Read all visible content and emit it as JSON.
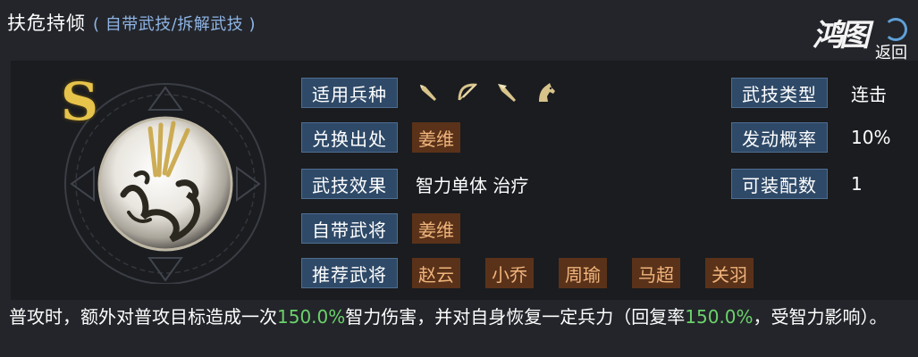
{
  "header": {
    "title": "扶危持倾",
    "subtitle": "( 自带武技/拆解武技 )",
    "logo_text": "鸿图",
    "return_label": "返回"
  },
  "skill": {
    "grade": "S",
    "fields": {
      "troops": {
        "label": "适用兵种",
        "icons": [
          "spear-icon",
          "bow-icon",
          "blade-icon",
          "horse-icon"
        ]
      },
      "source": {
        "label": "兑换出处",
        "value": "姜维"
      },
      "effect": {
        "label": "武技效果",
        "value": "智力单体 治疗"
      },
      "own_general": {
        "label": "自带武将",
        "value": "姜维"
      },
      "recommended": {
        "label": "推荐武将",
        "values": [
          "赵云",
          "小乔",
          "周瑜",
          "马超",
          "关羽"
        ]
      },
      "type": {
        "label": "武技类型",
        "value": "连击"
      },
      "trigger_rate": {
        "label": "发动概率",
        "value": "10%"
      },
      "equip_count": {
        "label": "可装配数",
        "value": "1"
      }
    },
    "description": {
      "part1": "普攻时，额外对普攻目标造成一次",
      "pct1": "150.0%",
      "part2": "智力伤害，并对自身恢复一定兵力（回复率",
      "pct2": "150.0%",
      "part3": "，受智力影响）。"
    }
  },
  "colors": {
    "label_bg": "#2f4a68",
    "chip_bg": "#5a3219",
    "chip_text": "#f0b47c",
    "highlight_green": "#6bd26b",
    "subtitle_blue": "#8fb5e6",
    "grade_gold": "#e6c34a"
  }
}
